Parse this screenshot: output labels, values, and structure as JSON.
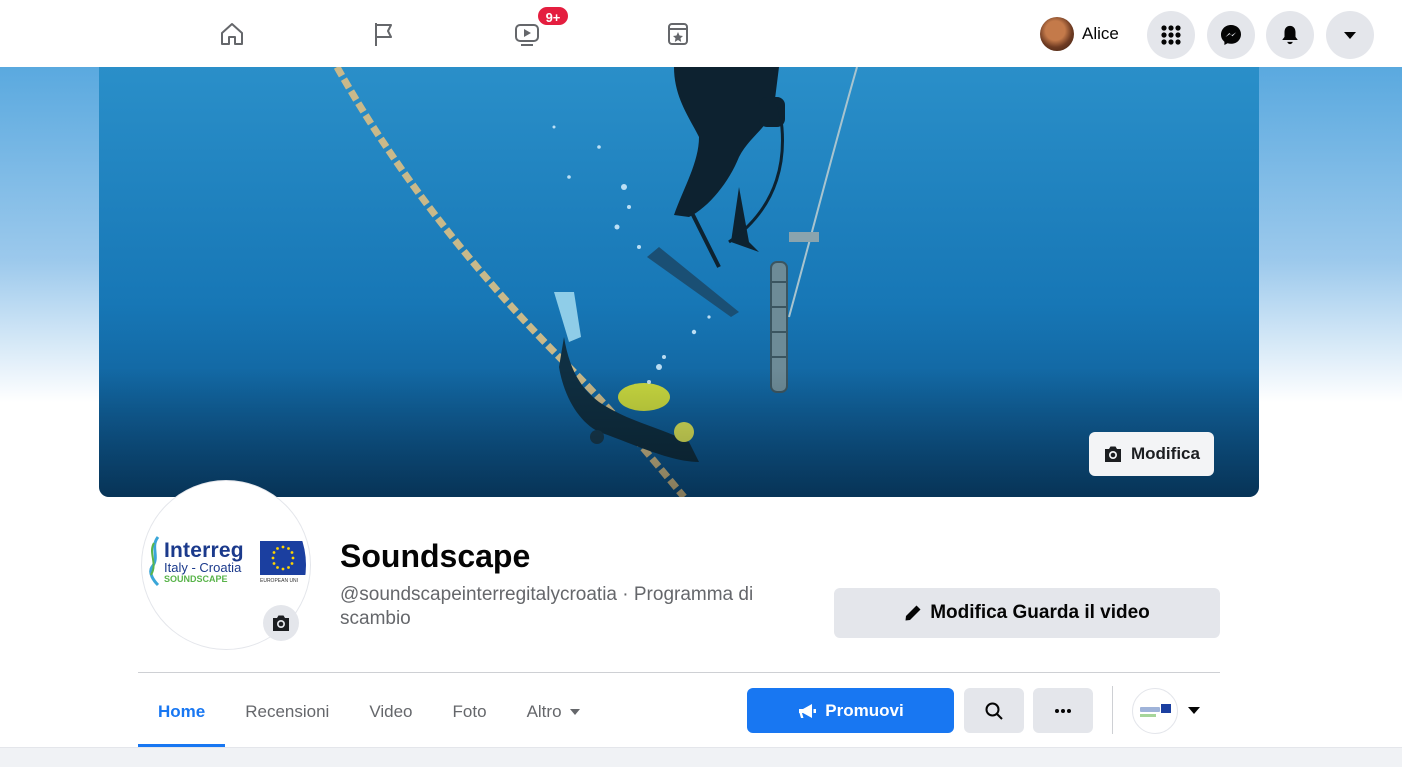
{
  "topbar": {
    "nav_icons": [
      "home-icon",
      "flag-icon",
      "watch-icon",
      "marketplace-icon"
    ],
    "watch_badge": "9+",
    "profile_name": "Alice",
    "round_buttons": [
      "menu-grid-icon",
      "messenger-icon",
      "notifications-bell-icon",
      "account-caret-icon"
    ]
  },
  "cover": {
    "edit_label": "Modifica"
  },
  "logo": {
    "line1": "Interreg",
    "line2": "Italy - Croatia",
    "line3": "SOUNDSCAPE",
    "eu_text": "EUROPEAN UNI"
  },
  "page": {
    "title": "Soundscape",
    "subtitle": "@soundscapeinterregitalycroatia · Programma di scambio",
    "watch_button": "Modifica Guarda il video"
  },
  "tabs": {
    "items": [
      "Home",
      "Recensioni",
      "Video",
      "Foto",
      "Altro"
    ],
    "active": "Home",
    "promote_label": "Promuovi"
  },
  "colors": {
    "accent": "#1877f2",
    "badge": "#e41e3f",
    "button_grey": "#e4e6eb"
  }
}
